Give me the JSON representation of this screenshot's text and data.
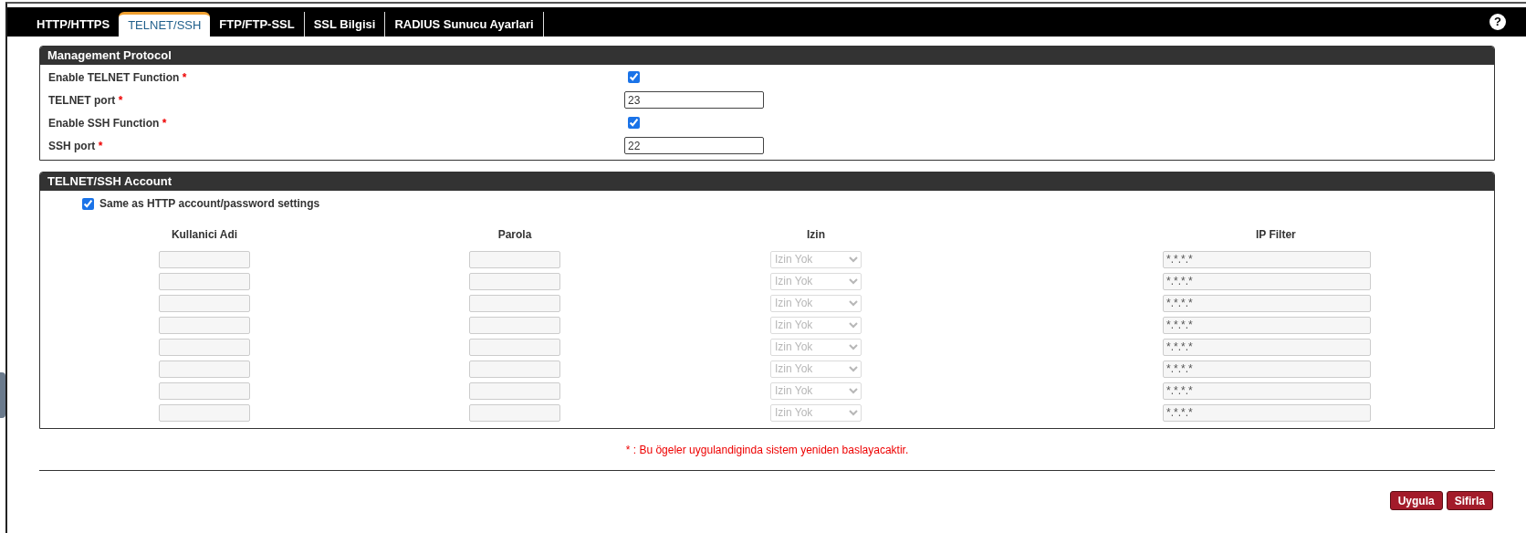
{
  "tabs": [
    {
      "label": "HTTP/HTTPS",
      "selected": false
    },
    {
      "label": "TELNET/SSH",
      "selected": true
    },
    {
      "label": "FTP/FTP-SSL",
      "selected": false
    },
    {
      "label": "SSL Bilgisi",
      "selected": false
    },
    {
      "label": "RADIUS Sunucu Ayarlari",
      "selected": false
    }
  ],
  "help_button": "?",
  "management_protocol": {
    "title": "Management Protocol",
    "rows": [
      {
        "kind": "checkbox",
        "label": "Enable TELNET Function",
        "mark": "*",
        "checked": true
      },
      {
        "kind": "text",
        "label": "TELNET port",
        "mark": "*",
        "value": "23"
      },
      {
        "kind": "checkbox",
        "label": "Enable SSH Function",
        "mark": "*",
        "checked": true
      },
      {
        "kind": "text",
        "label": "SSH port",
        "mark": "*",
        "value": "22"
      }
    ]
  },
  "account": {
    "title": "TELNET/SSH Account",
    "same_as_http": {
      "label": "Same as HTTP account/password settings",
      "checked": true
    },
    "columns": [
      "Kullanici Adi",
      "Parola",
      "Izin",
      "IP Filter"
    ],
    "rows": [
      {
        "permission": "Izin Yok",
        "ip_filter": "*.*.*.*",
        "disabled": true
      },
      {
        "permission": "Izin Yok",
        "ip_filter": "*.*.*.*",
        "disabled": true
      },
      {
        "permission": "Izin Yok",
        "ip_filter": "*.*.*.*",
        "disabled": true
      },
      {
        "permission": "Izin Yok",
        "ip_filter": "*.*.*.*",
        "disabled": true
      },
      {
        "permission": "Izin Yok",
        "ip_filter": "*.*.*.*",
        "disabled": true
      },
      {
        "permission": "Izin Yok",
        "ip_filter": "*.*.*.*",
        "disabled": true
      },
      {
        "permission": "Izin Yok",
        "ip_filter": "*.*.*.*",
        "disabled": true
      },
      {
        "permission": "Izin Yok",
        "ip_filter": "*.*.*.*",
        "disabled": true
      }
    ]
  },
  "note": "* : Bu ögeler uygulandiginda sistem yeniden baslayacaktir.",
  "buttons": [
    {
      "label": "Uygula"
    },
    {
      "label": "Sifirla"
    }
  ]
}
